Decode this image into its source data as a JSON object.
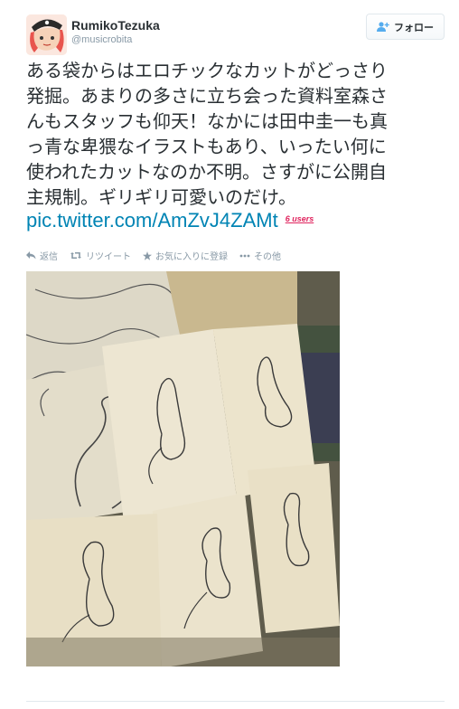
{
  "header": {
    "display_name": "RumikoTezuka",
    "handle": "@musicrobita",
    "follow_label": "フォロー"
  },
  "tweet": {
    "lines": [
      "ある袋からはエロチックなカットがどっさり",
      "発掘。あまりの多さに立ち会った資料室森さ",
      "んもスタッフも仰天！なかには田中圭一も真",
      "っ青な卑猥なイラストもあり、いったい何に",
      "使われたカットなのか不明。さすがに公開自",
      "主規制。ギリギリ可愛いのだけ。"
    ],
    "link": "pic.twitter.com/AmZvJ4ZAMt",
    "users_badge": "6 users"
  },
  "actions": {
    "reply": "返信",
    "retweet": "リツイート",
    "favorite": "お気に入りに登録",
    "more": "その他"
  },
  "colors": {
    "link": "#0084b4",
    "muted": "#8899a6",
    "badge": "#e0245e",
    "text": "#292f33"
  },
  "icons": {
    "follow": "person-plus-icon",
    "reply": "reply-icon",
    "retweet": "retweet-icon",
    "favorite": "star-icon",
    "more": "ellipsis-icon"
  }
}
